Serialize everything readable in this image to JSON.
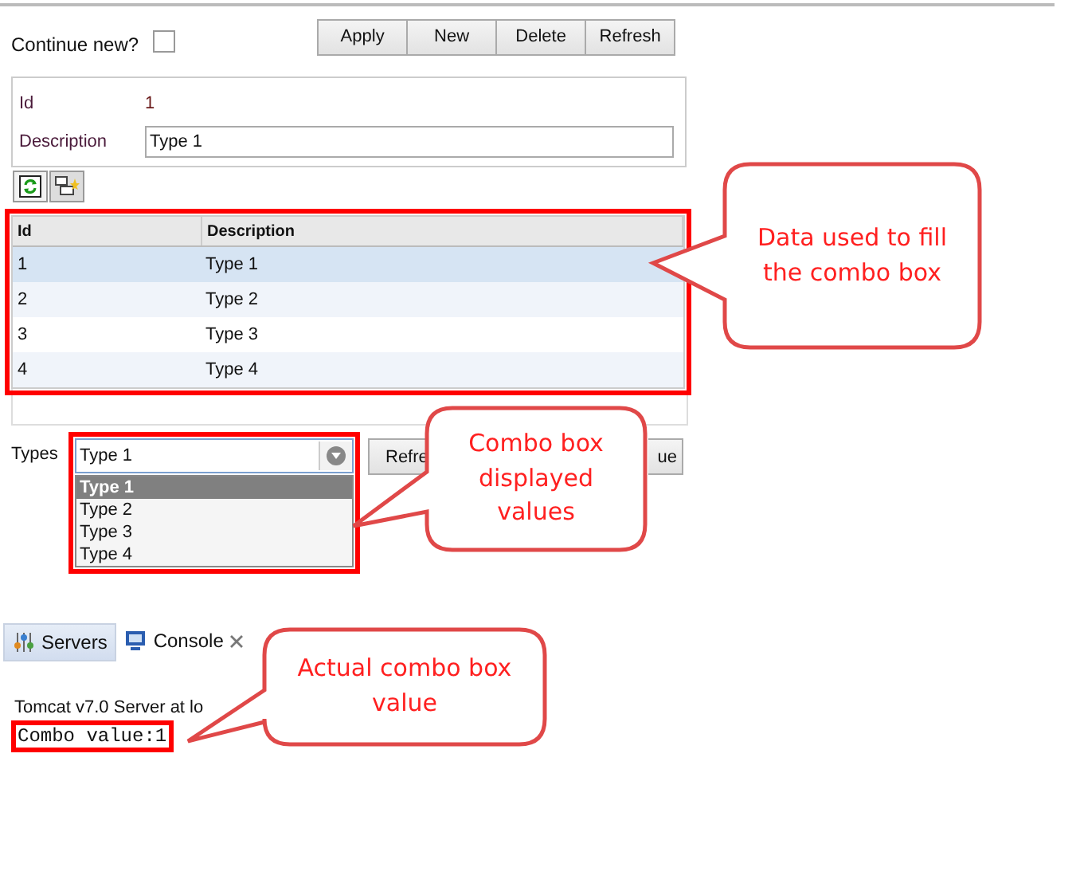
{
  "toolbar": {
    "continue_new": {
      "label": "Continue new?",
      "checked": false
    },
    "buttons": [
      "Apply",
      "New",
      "Delete",
      "Refresh"
    ]
  },
  "form": {
    "fields": [
      {
        "label": "Id",
        "value": "1",
        "kind": "text"
      },
      {
        "label": "Description",
        "value": "Type 1",
        "kind": "input"
      }
    ]
  },
  "grid": {
    "columns": [
      "Id",
      "Description"
    ],
    "rows": [
      {
        "cells": [
          "1",
          "Type 1"
        ],
        "selected": true
      },
      {
        "cells": [
          "2",
          "Type 2"
        ],
        "selected": false
      },
      {
        "cells": [
          "3",
          "Type 3"
        ],
        "selected": false
      },
      {
        "cells": [
          "4",
          "Type 4"
        ],
        "selected": false
      }
    ]
  },
  "types": {
    "label": "Types",
    "value": "Type 1",
    "options": [
      {
        "label": "Type 1",
        "selected": true
      },
      {
        "label": "Type 2",
        "selected": false
      },
      {
        "label": "Type 3",
        "selected": false
      },
      {
        "label": "Type 4",
        "selected": false
      }
    ],
    "buttons": [
      "Refre",
      "ue"
    ]
  },
  "console_tabs": [
    {
      "label": "Servers",
      "selected": false,
      "closable": false
    },
    {
      "label": "Console",
      "selected": true,
      "closable": true
    }
  ],
  "console": {
    "lines": [
      "Tomcat v7.0 Server at lo",
      "Combo value:1"
    ]
  },
  "callouts": [
    {
      "text": "Data used to fill the combo box"
    },
    {
      "text": "Combo box displayed values"
    },
    {
      "text": "Actual combo box value"
    }
  ]
}
